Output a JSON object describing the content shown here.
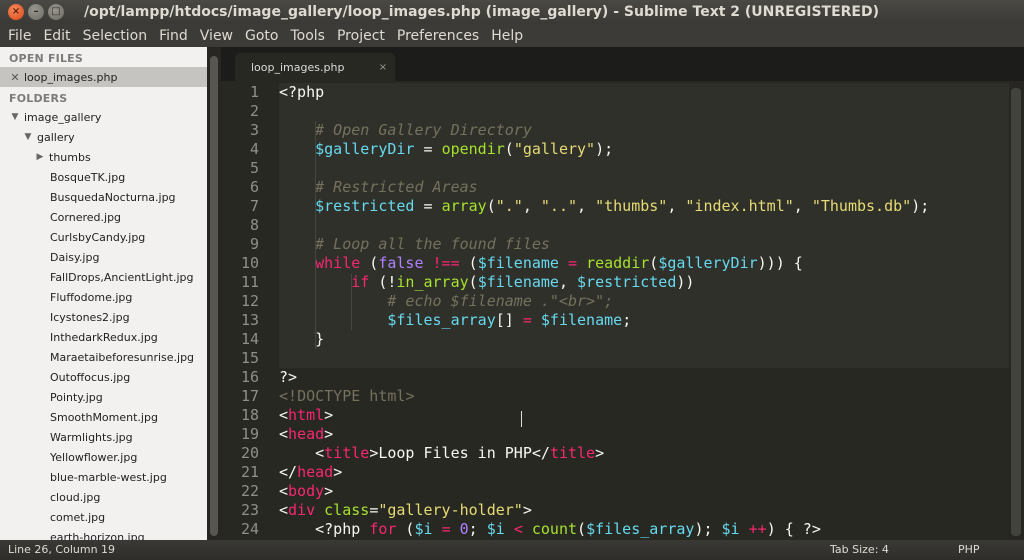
{
  "window": {
    "title": "/opt/lampp/htdocs/image_gallery/loop_images.php (image_gallery) - Sublime Text 2 (UNREGISTERED)",
    "close_glyph": "×",
    "minimize_glyph": "–",
    "maximize_glyph": "□"
  },
  "menu": [
    "File",
    "Edit",
    "Selection",
    "Find",
    "View",
    "Goto",
    "Tools",
    "Project",
    "Preferences",
    "Help"
  ],
  "sidebar": {
    "open_files_header": "OPEN FILES",
    "open_files": [
      {
        "name": "loop_images.php",
        "close_glyph": "✕"
      }
    ],
    "folders_header": "FOLDERS",
    "root": "image_gallery",
    "gallery": "gallery",
    "thumbs": "thumbs",
    "files": [
      "BosqueTK.jpg",
      "BusquedaNocturna.jpg",
      "Cornered.jpg",
      "CurlsbyCandy.jpg",
      "Daisy.jpg",
      "FallDrops,AncientLight.jpg",
      "Fluffodome.jpg",
      "Icystones2.jpg",
      "InthedarkRedux.jpg",
      "Maraetaibeforesunrise.jpg",
      "Outoffocus.jpg",
      "Pointy.jpg",
      "SmoothMoment.jpg",
      "Warmlights.jpg",
      "Yellowflower.jpg",
      "blue-marble-west.jpg",
      "cloud.jpg",
      "comet.jpg",
      "earth-horizon.jpg"
    ]
  },
  "tab": {
    "label": "loop_images.php",
    "close_glyph": "×"
  },
  "code_lines": [
    {
      "n": "1",
      "tokens": [
        [
          "",
          "<?php"
        ]
      ]
    },
    {
      "n": "2",
      "tokens": []
    },
    {
      "n": "3",
      "tokens": [
        [
          "",
          "    "
        ],
        [
          "c-cm",
          "# Open Gallery Directory"
        ]
      ]
    },
    {
      "n": "4",
      "tokens": [
        [
          "",
          "    "
        ],
        [
          "c-var",
          "$galleryDir"
        ],
        [
          "",
          " = "
        ],
        [
          "c-fn",
          "opendir"
        ],
        [
          "",
          "("
        ],
        [
          "c-str",
          "\"gallery\""
        ],
        [
          "",
          ");"
        ]
      ]
    },
    {
      "n": "5",
      "tokens": []
    },
    {
      "n": "6",
      "tokens": [
        [
          "",
          "    "
        ],
        [
          "c-cm",
          "# Restricted Areas"
        ]
      ]
    },
    {
      "n": "7",
      "tokens": [
        [
          "",
          "    "
        ],
        [
          "c-var",
          "$restricted"
        ],
        [
          "",
          " = "
        ],
        [
          "c-fn",
          "array"
        ],
        [
          "",
          "("
        ],
        [
          "c-str",
          "\".\""
        ],
        [
          "",
          ", "
        ],
        [
          "c-str",
          "\"..\""
        ],
        [
          "",
          ", "
        ],
        [
          "c-str",
          "\"thumbs\""
        ],
        [
          "",
          ", "
        ],
        [
          "c-str",
          "\"index.html\""
        ],
        [
          "",
          ", "
        ],
        [
          "c-str",
          "\"Thumbs.db\""
        ],
        [
          "",
          ");"
        ]
      ]
    },
    {
      "n": "8",
      "tokens": []
    },
    {
      "n": "9",
      "tokens": [
        [
          "",
          "    "
        ],
        [
          "c-cm",
          "# Loop all the found files"
        ]
      ]
    },
    {
      "n": "10",
      "tokens": [
        [
          "",
          "    "
        ],
        [
          "c-kw",
          "while"
        ],
        [
          "",
          " ("
        ],
        [
          "c-const",
          "false"
        ],
        [
          "",
          " "
        ],
        [
          "c-kw",
          "!=="
        ],
        [
          "",
          " ("
        ],
        [
          "c-var",
          "$filename"
        ],
        [
          "",
          " "
        ],
        [
          "c-kw",
          "="
        ],
        [
          "",
          " "
        ],
        [
          "c-fn",
          "readdir"
        ],
        [
          "",
          "("
        ],
        [
          "c-var",
          "$galleryDir"
        ],
        [
          "",
          ")))"
        ],
        [
          "",
          " {"
        ]
      ]
    },
    {
      "n": "11",
      "tokens": [
        [
          "",
          "        "
        ],
        [
          "c-kw",
          "if"
        ],
        [
          "",
          " (!"
        ],
        [
          "c-fn",
          "in_array"
        ],
        [
          "",
          "("
        ],
        [
          "c-var",
          "$filename"
        ],
        [
          "",
          ", "
        ],
        [
          "c-var",
          "$restricted"
        ],
        [
          "",
          "))"
        ]
      ]
    },
    {
      "n": "12",
      "tokens": [
        [
          "",
          "            "
        ],
        [
          "c-cm",
          "# echo $filename .\"<br>\";"
        ]
      ]
    },
    {
      "n": "13",
      "tokens": [
        [
          "",
          "            "
        ],
        [
          "c-var",
          "$files_array"
        ],
        [
          "",
          "[] "
        ],
        [
          "c-kw",
          "="
        ],
        [
          "",
          " "
        ],
        [
          "c-var",
          "$filename"
        ],
        [
          "",
          ";"
        ]
      ]
    },
    {
      "n": "14",
      "tokens": [
        [
          "",
          "    }"
        ]
      ]
    },
    {
      "n": "15",
      "tokens": []
    },
    {
      "n": "16",
      "tokens": [
        [
          "",
          "?>"
        ]
      ]
    },
    {
      "n": "17",
      "tokens": [
        [
          "c-dim",
          "<!"
        ],
        [
          "c-dim",
          "DOCTYPE html"
        ],
        [
          "c-dim",
          ">"
        ]
      ]
    },
    {
      "n": "18",
      "tokens": [
        [
          "",
          "<"
        ],
        [
          "c-tag",
          "html"
        ],
        [
          "",
          ">"
        ]
      ]
    },
    {
      "n": "19",
      "tokens": [
        [
          "",
          "<"
        ],
        [
          "c-tag",
          "head"
        ],
        [
          "",
          ">"
        ]
      ]
    },
    {
      "n": "20",
      "tokens": [
        [
          "",
          "    <"
        ],
        [
          "c-tag",
          "title"
        ],
        [
          "",
          ">Loop Files in PHP</"
        ],
        [
          "c-tag",
          "title"
        ],
        [
          "",
          ">"
        ]
      ]
    },
    {
      "n": "21",
      "tokens": [
        [
          "",
          "</"
        ],
        [
          "c-tag",
          "head"
        ],
        [
          "",
          ">"
        ]
      ]
    },
    {
      "n": "22",
      "tokens": [
        [
          "",
          "<"
        ],
        [
          "c-tag",
          "body"
        ],
        [
          "",
          ">"
        ]
      ]
    },
    {
      "n": "23",
      "tokens": [
        [
          "",
          "<"
        ],
        [
          "c-tag",
          "div"
        ],
        [
          "",
          " "
        ],
        [
          "c-attr",
          "class"
        ],
        [
          "",
          "="
        ],
        [
          "c-str",
          "\"gallery-holder\""
        ],
        [
          "",
          ">"
        ]
      ]
    },
    {
      "n": "24",
      "tokens": [
        [
          "",
          "    <?php "
        ],
        [
          "c-kw",
          "for"
        ],
        [
          "",
          " ("
        ],
        [
          "c-var",
          "$i"
        ],
        [
          "",
          " "
        ],
        [
          "c-kw",
          "="
        ],
        [
          "",
          " "
        ],
        [
          "c-const",
          "0"
        ],
        [
          "",
          "; "
        ],
        [
          "c-var",
          "$i"
        ],
        [
          "",
          " "
        ],
        [
          "c-kw",
          "<"
        ],
        [
          "",
          " "
        ],
        [
          "c-fn",
          "count"
        ],
        [
          "",
          "("
        ],
        [
          "c-var",
          "$files_array"
        ],
        [
          "",
          "); "
        ],
        [
          "c-var",
          "$i"
        ],
        [
          "",
          " "
        ],
        [
          "c-kw",
          "++"
        ],
        [
          "",
          ") { ?>"
        ]
      ]
    }
  ],
  "status": {
    "position": "Line 26, Column 19",
    "tab_size": "Tab Size: 4",
    "syntax": "PHP"
  },
  "colors": {
    "editor_bg": "#272822",
    "sidebar_bg": "#f2f1ef",
    "close_button": "#dd4814"
  }
}
